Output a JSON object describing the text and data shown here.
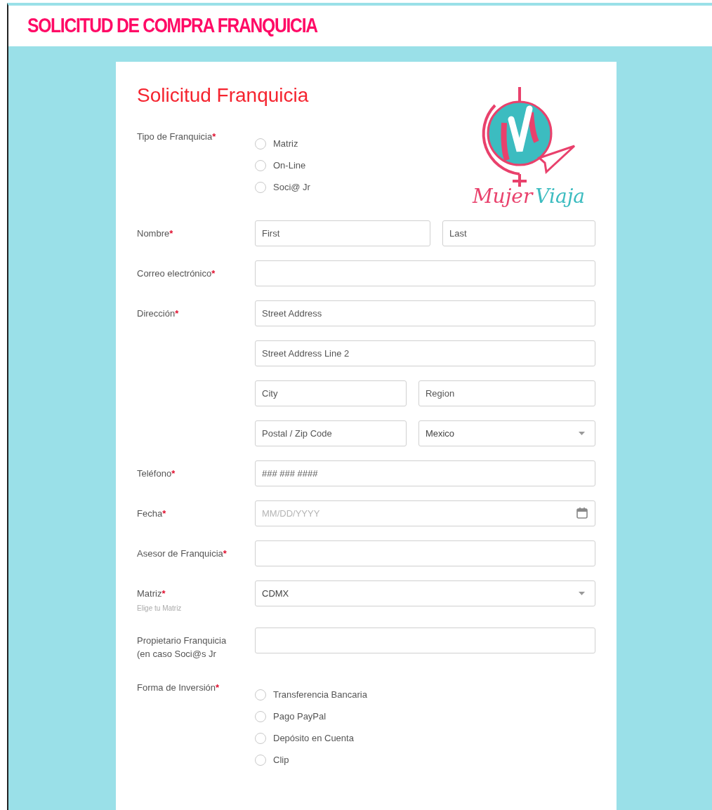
{
  "header": {
    "title": "SOLICITUD DE COMPRA FRANQUICIA"
  },
  "form": {
    "title": "Solicitud Franquicia",
    "logo": {
      "word_1": "Mujer",
      "word_2": "Viaja"
    },
    "fields": [
      {
        "label": "Tipo de Franquicia",
        "mark": "*",
        "kind": "radio",
        "options": [
          {
            "label": "Matriz",
            "selected": false
          },
          {
            "label": "On-Line",
            "selected": false
          },
          {
            "label": "Soci@ Jr",
            "selected": false
          }
        ]
      },
      {
        "label": "Nombre",
        "mark": "*",
        "kind": "inputs",
        "rows": [
          [
            {
              "kind": "text",
              "placeholder": "First"
            },
            {
              "kind": "text",
              "placeholder": "Last"
            }
          ]
        ]
      },
      {
        "label": "Correo electrónico",
        "mark": "*",
        "kind": "inputs",
        "rows": [
          [
            {
              "kind": "text"
            }
          ]
        ]
      },
      {
        "label": "Dirección",
        "mark": "*",
        "kind": "inputs",
        "rows": [
          [
            {
              "kind": "text",
              "placeholder": "Street Address"
            }
          ],
          [
            {
              "kind": "text",
              "placeholder": "Street Address Line 2"
            }
          ],
          [
            {
              "kind": "text",
              "placeholder": "City"
            },
            {
              "kind": "text",
              "placeholder": "Region"
            }
          ],
          [
            {
              "kind": "text",
              "placeholder": "Postal / Zip Code"
            },
            {
              "kind": "select",
              "value": "Mexico"
            }
          ]
        ]
      },
      {
        "label": "Teléfono",
        "mark": "*",
        "kind": "inputs",
        "rows": [
          [
            {
              "kind": "text",
              "placeholder": "### ### ####"
            }
          ]
        ]
      },
      {
        "label": "Fecha",
        "mark": "*",
        "kind": "inputs",
        "rows": [
          [
            {
              "kind": "date",
              "placeholder": "MM/DD/YYYY"
            }
          ]
        ]
      },
      {
        "label": "Asesor de Franquicia",
        "mark": "*",
        "kind": "inputs",
        "rows": [
          [
            {
              "kind": "text"
            }
          ]
        ]
      },
      {
        "label": "Matriz",
        "mark": "*",
        "sublabel": "Elige tu Matriz",
        "kind": "inputs",
        "rows": [
          [
            {
              "kind": "select",
              "value": "CDMX"
            }
          ]
        ]
      },
      {
        "label": "Propietario Franquicia (en caso Soci@s Jr",
        "kind": "inputs",
        "rows": [
          [
            {
              "kind": "text"
            }
          ]
        ]
      },
      {
        "label": "Forma de Inversión",
        "mark": "*",
        "kind": "radio",
        "options": [
          {
            "label": "Transferencia Bancaria",
            "selected": false
          },
          {
            "label": "Pago PayPal",
            "selected": false
          },
          {
            "label": "Depósito en Cuenta",
            "selected": false
          },
          {
            "label": "Clip",
            "selected": false
          }
        ]
      }
    ]
  }
}
